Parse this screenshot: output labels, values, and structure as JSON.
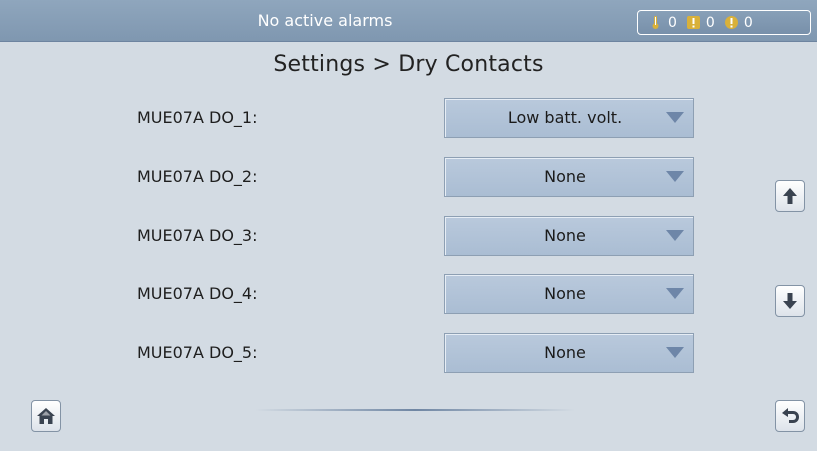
{
  "status_bar": {
    "message": "No active alarms",
    "alarms": [
      {
        "type": "critical",
        "icon": "thermometer-alarm-icon",
        "count": "0",
        "color": "#d9b13a"
      },
      {
        "type": "major",
        "icon": "exclamation-square-icon",
        "count": "0",
        "color": "#d9b13a"
      },
      {
        "type": "minor",
        "icon": "exclamation-circle-icon",
        "count": "0",
        "color": "#d9b13a"
      }
    ]
  },
  "page": {
    "title": "Settings > Dry Contacts"
  },
  "rows": [
    {
      "label": "MUE07A DO_1:",
      "value": "Low batt. volt."
    },
    {
      "label": "MUE07A DO_2:",
      "value": "None"
    },
    {
      "label": "MUE07A DO_3:",
      "value": "None"
    },
    {
      "label": "MUE07A DO_4:",
      "value": "None"
    },
    {
      "label": "MUE07A DO_5:",
      "value": "None"
    }
  ],
  "navigation": {
    "scroll_up_icon": "arrow-up-icon",
    "scroll_down_icon": "arrow-down-icon",
    "home_icon": "home-icon",
    "back_icon": "back-arrow-icon"
  },
  "colors": {
    "background": "#d3dbe3",
    "header": "#8199b2",
    "dropdown": "#b0c2d7",
    "alarm_icon": "#d9b13a"
  }
}
